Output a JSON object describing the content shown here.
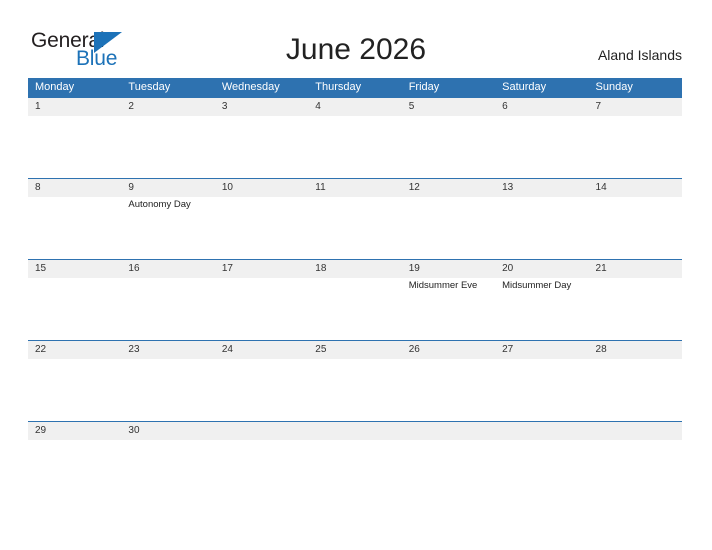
{
  "logo": {
    "word_one": "General",
    "word_two": "Blue",
    "triangle_icon": "triangle-icon",
    "brand_color": "#1c72b8"
  },
  "header": {
    "title": "June 2026",
    "region": "Aland Islands"
  },
  "calendar": {
    "header_color": "#2e72b0",
    "band_color": "#f0f0f0",
    "weekdays": [
      "Monday",
      "Tuesday",
      "Wednesday",
      "Thursday",
      "Friday",
      "Saturday",
      "Sunday"
    ],
    "weeks": [
      [
        {
          "day": "1",
          "event": ""
        },
        {
          "day": "2",
          "event": ""
        },
        {
          "day": "3",
          "event": ""
        },
        {
          "day": "4",
          "event": ""
        },
        {
          "day": "5",
          "event": ""
        },
        {
          "day": "6",
          "event": ""
        },
        {
          "day": "7",
          "event": ""
        }
      ],
      [
        {
          "day": "8",
          "event": ""
        },
        {
          "day": "9",
          "event": "Autonomy Day"
        },
        {
          "day": "10",
          "event": ""
        },
        {
          "day": "11",
          "event": ""
        },
        {
          "day": "12",
          "event": ""
        },
        {
          "day": "13",
          "event": ""
        },
        {
          "day": "14",
          "event": ""
        }
      ],
      [
        {
          "day": "15",
          "event": ""
        },
        {
          "day": "16",
          "event": ""
        },
        {
          "day": "17",
          "event": ""
        },
        {
          "day": "18",
          "event": ""
        },
        {
          "day": "19",
          "event": "Midsummer Eve"
        },
        {
          "day": "20",
          "event": "Midsummer Day"
        },
        {
          "day": "21",
          "event": ""
        }
      ],
      [
        {
          "day": "22",
          "event": ""
        },
        {
          "day": "23",
          "event": ""
        },
        {
          "day": "24",
          "event": ""
        },
        {
          "day": "25",
          "event": ""
        },
        {
          "day": "26",
          "event": ""
        },
        {
          "day": "27",
          "event": ""
        },
        {
          "day": "28",
          "event": ""
        }
      ],
      [
        {
          "day": "29",
          "event": ""
        },
        {
          "day": "30",
          "event": ""
        },
        {
          "day": "",
          "event": ""
        },
        {
          "day": "",
          "event": ""
        },
        {
          "day": "",
          "event": ""
        },
        {
          "day": "",
          "event": ""
        },
        {
          "day": "",
          "event": ""
        }
      ]
    ]
  }
}
